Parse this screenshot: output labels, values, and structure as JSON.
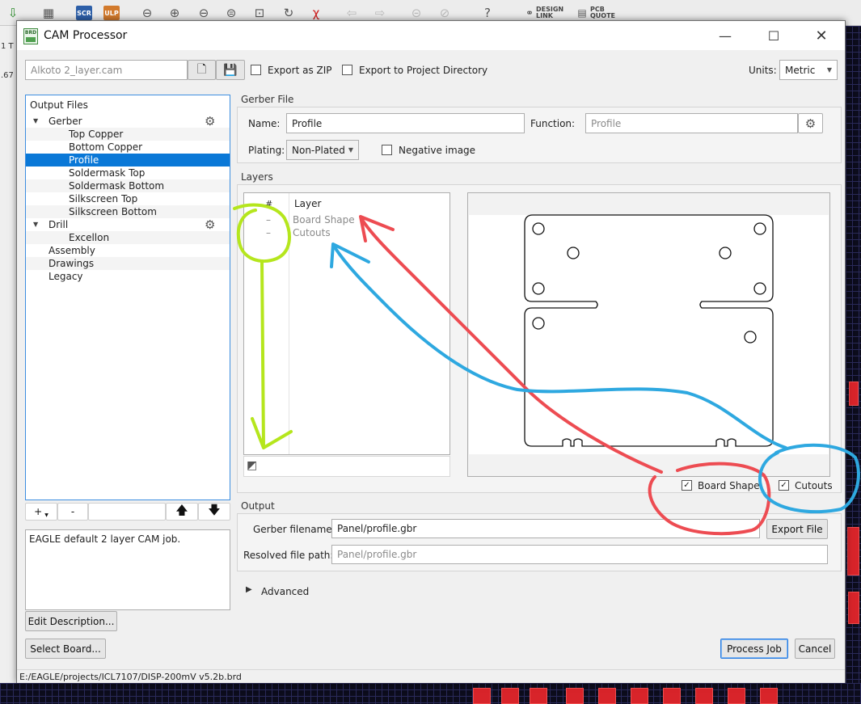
{
  "background_app": {
    "toolbar": {
      "scr_label": "SCR",
      "ulp_label": "ULP",
      "design_link": [
        "DESIGN",
        "LINK"
      ],
      "pcb_quote": [
        "PCB",
        "QUOTE"
      ]
    },
    "left_fragments": [
      "1 T",
      ".67"
    ]
  },
  "window": {
    "title": "CAM Processor",
    "icon_text": "BRD"
  },
  "top_bar": {
    "job_file": "Alkoto 2_layer.cam",
    "export_zip_label": "Export as ZIP",
    "export_zip_checked": false,
    "export_project_label": "Export to Project Directory",
    "export_project_checked": false,
    "units_label": "Units:",
    "units_value": "Metric"
  },
  "output_files": {
    "header": "Output Files",
    "items": [
      {
        "label": "Gerber",
        "level": 0,
        "expandable": true,
        "gear": true
      },
      {
        "label": "Top Copper",
        "level": 1
      },
      {
        "label": "Bottom Copper",
        "level": 1
      },
      {
        "label": "Profile",
        "level": 1,
        "selected": true
      },
      {
        "label": "Soldermask Top",
        "level": 1
      },
      {
        "label": "Soldermask Bottom",
        "level": 1
      },
      {
        "label": "Silkscreen Top",
        "level": 1
      },
      {
        "label": "Silkscreen Bottom",
        "level": 1
      },
      {
        "label": "Drill",
        "level": 0,
        "expandable": true,
        "gear": true
      },
      {
        "label": "Excellon",
        "level": 1
      },
      {
        "label": "Assembly",
        "level": 0
      },
      {
        "label": "Drawings",
        "level": 0
      },
      {
        "label": "Legacy",
        "level": 0
      }
    ],
    "add_label": "+",
    "remove_label": "-"
  },
  "description": "EAGLE default 2 layer CAM job.",
  "edit_description_label": "Edit Description...",
  "select_board_label": "Select Board...",
  "gerber_file": {
    "section": "Gerber File",
    "name_label": "Name:",
    "name_value": "Profile",
    "function_label": "Function:",
    "function_value": "Profile",
    "plating_label": "Plating:",
    "plating_value": "Non-Plated",
    "negative_label": "Negative image",
    "negative_checked": false
  },
  "layers": {
    "section": "Layers",
    "col_num": "#",
    "col_layer": "Layer",
    "rows": [
      {
        "num": "–",
        "name": "Board Shape"
      },
      {
        "num": "–",
        "name": "Cutouts"
      }
    ],
    "board_shape_label": "Board Shape",
    "board_shape_checked": true,
    "cutouts_label": "Cutouts",
    "cutouts_checked": true
  },
  "output": {
    "section": "Output",
    "gerber_filename_label": "Gerber filename:",
    "gerber_filename_value": "Panel/profile.gbr",
    "export_file_label": "Export File",
    "resolved_label": "Resolved file path:",
    "resolved_value": "Panel/profile.gbr"
  },
  "advanced_label": "Advanced",
  "process_job_label": "Process Job",
  "cancel_label": "Cancel",
  "status_path": "E:/EAGLE/projects/ICL7107/DISP-200mV v5.2b.brd",
  "colors": {
    "accent": "#0a78d7",
    "annotation_green": "#b5e61d",
    "annotation_red": "#ed4c52",
    "annotation_blue": "#2ea8e0"
  }
}
